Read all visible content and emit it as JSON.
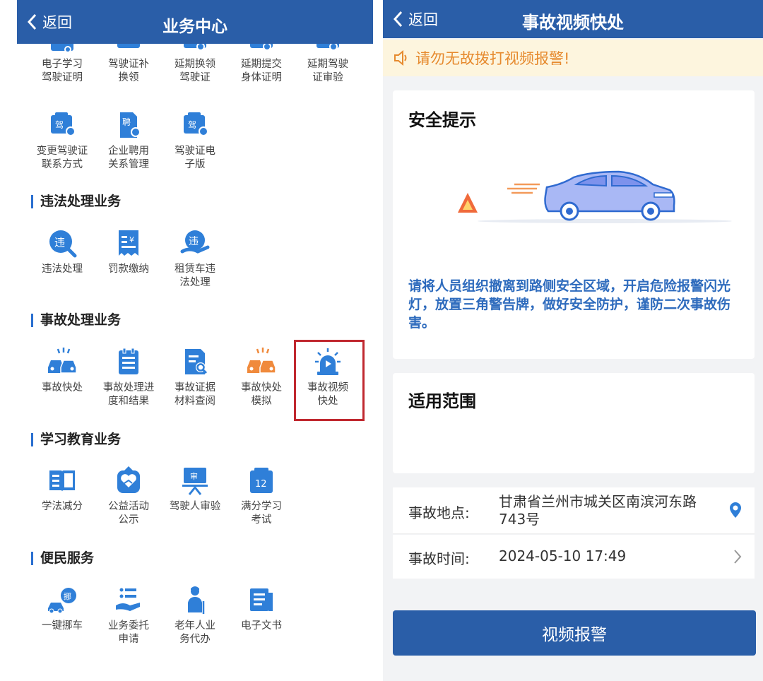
{
  "left": {
    "header": {
      "back_label": "返回",
      "title": "业务中心"
    },
    "top_partial_items": [
      "电子学习\n驾驶证明",
      "驾驶证补\n换领",
      "延期换领\n驾驶证",
      "延期提交\n身体证明",
      "延期驾驶\n证审验"
    ],
    "driver_items": [
      "变更驾驶证\n联系方式",
      "企业聘用\n关系管理",
      "驾驶证电\n子版"
    ],
    "sections": [
      {
        "title": "违法处理业务",
        "items": [
          "违法处理",
          "罚款缴纳",
          "租赁车违\n法处理"
        ]
      },
      {
        "title": "事故处理业务",
        "items": [
          "事故快处",
          "事故处理进\n度和结果",
          "事故证据\n材料查阅",
          "事故快处\n模拟",
          "事故视频\n快处"
        ]
      },
      {
        "title": "学习教育业务",
        "items": [
          "学法减分",
          "公益活动\n公示",
          "驾驶人审验",
          "满分学习\n考试"
        ]
      },
      {
        "title": "便民服务",
        "items": [
          "一键挪车",
          "业务委托\n申请",
          "老年人业\n务代办",
          "电子文书"
        ]
      }
    ],
    "icon_glyphs": {
      "jia": "驾",
      "pin": "聘",
      "wei": "违",
      "shen": "审",
      "num": "12",
      "nuo": "挪"
    }
  },
  "right": {
    "header": {
      "back_label": "返回",
      "title": "事故视频快处"
    },
    "notice": "请勿无故拨打视频报警!",
    "safety": {
      "title": "安全提示",
      "tip": "请将人员组织撤离到路侧安全区域，开启危险报警闪光灯，放置三角警告牌，做好安全防护，谨防二次事故伤害。"
    },
    "scope": {
      "title": "适用范围"
    },
    "location": {
      "label": "事故地点:",
      "value": "甘肃省兰州市城关区南滨河东路743号"
    },
    "time": {
      "label": "事故时间:",
      "value": "2024-05-10 17:49"
    },
    "submit": "视频报警"
  },
  "colors": {
    "header_blue": "#2a5ea8",
    "icon_blue": "#2f7fd8",
    "icon_orange": "#f08a3c",
    "highlight_red": "#c0282f",
    "notice_bg": "#fdf5de",
    "notice_text": "#e68a2e",
    "tip_blue": "#2e6bbd"
  }
}
